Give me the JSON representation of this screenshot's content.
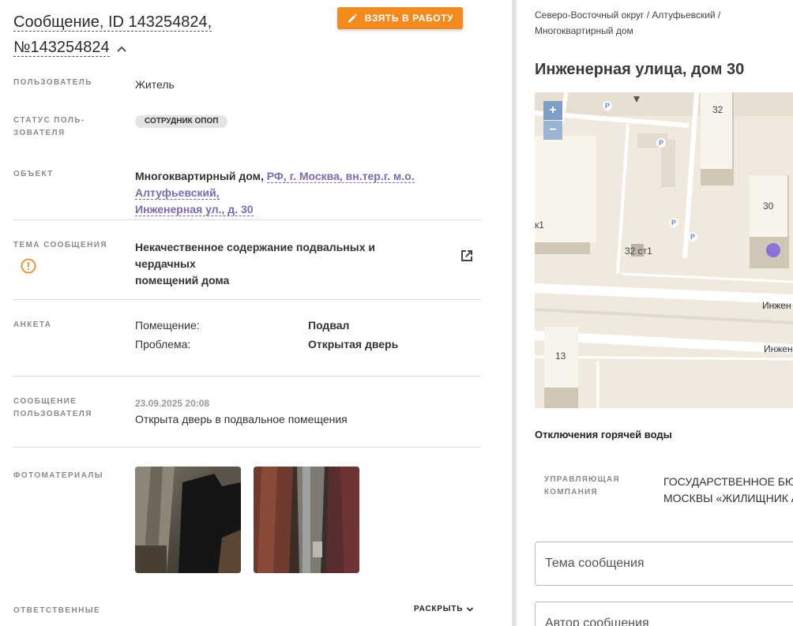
{
  "header": {
    "title_line1": "Сообщение, ID 143254824,",
    "title_line2": "№143254824",
    "take_button": "ВЗЯТЬ В РАБОТУ"
  },
  "fields": {
    "user_label": "ПОЛЬЗОВАТЕЛЬ",
    "user_value": "Житель",
    "status_label_1": "СТАТУС ПОЛЬ-",
    "status_label_2": "ЗОВАТЕЛЯ",
    "status_chip": "СОТРУДНИК ОПОП",
    "object_label": "ОБЪЕКТ",
    "object_type": "Многоквартирный дом,",
    "object_addr_1": "РФ, г. Москва, вн.тер.г. м.о. Алтуфьевский,",
    "object_addr_2": "Инженерная ул., д. 30",
    "topic_label": "ТЕМА СООБЩЕНИЯ",
    "topic_line1": "Некачественное содержание подвальных и чердачных",
    "topic_line2": "помещений дома",
    "survey_label": "АНКЕТА",
    "survey_room_label": "Помещение:",
    "survey_room_value": "Подвал",
    "survey_problem_label": "Проблема:",
    "survey_problem_value": "Открытая дверь",
    "msg_label_1": "СООБЩЕНИЕ",
    "msg_label_2": "ПОЛЬЗОВАТЕЛЯ",
    "msg_date": "23.09.2025 20:08",
    "msg_text": "Открыта дверь в подвальное помещения",
    "photos_label": "ФОТОМАТЕРИАЛЫ",
    "responsible_label": "ОТВЕТСТВЕННЫЕ",
    "expand": "РАСКРЫТЬ"
  },
  "right": {
    "crumb_line1": "Северо-Восточный округ / Алтуфьевский /",
    "crumb_line2": "Многоквартирный дом",
    "address": "Инженерная улица, дом 30",
    "map": {
      "zoom_in": "+",
      "zoom_out": "−",
      "parking": "P",
      "labels": [
        "32",
        "30",
        "к1",
        "32 ст1",
        "13",
        "Инжен",
        "Инжен"
      ]
    },
    "hot_water": "Отключения горячей воды",
    "mc_label_1": "УПРАВЛЯЮЩАЯ",
    "mc_label_2": "КОМПАНИЯ",
    "mc_value_1": "ГОСУДАРСТВЕННОЕ БЮД",
    "mc_value_2": "МОСКВЫ «ЖИЛИЩНИК А",
    "field_topic": "Тема сообщения",
    "field_author": "Автор сообщения"
  },
  "colors": {
    "accent": "#f28a1d",
    "link": "#7b6ab0",
    "warning": "#f28a1d",
    "map_marker": "#8b72d6"
  },
  "icons": [
    "pencil-icon",
    "chevron-up-icon",
    "warning-circle-icon",
    "open-external-icon",
    "chevron-down-icon"
  ]
}
